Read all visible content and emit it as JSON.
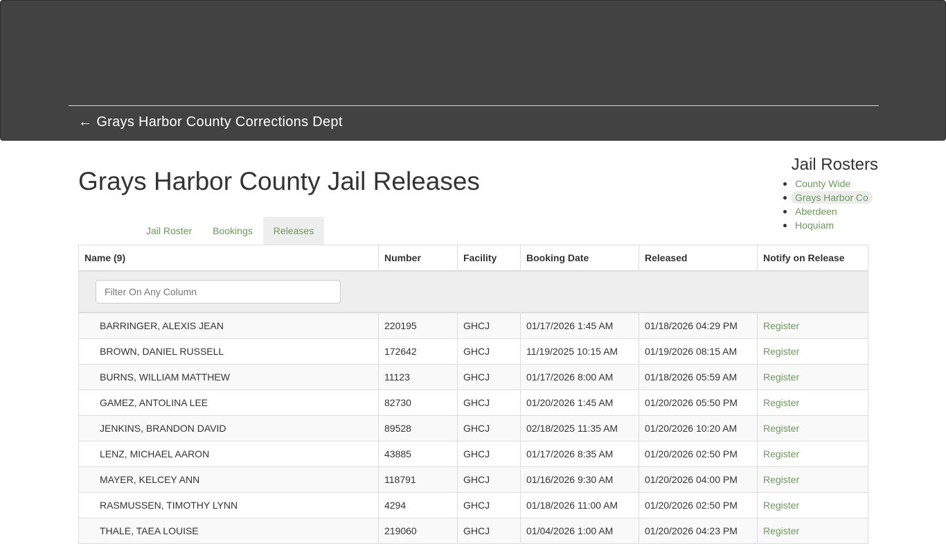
{
  "header": {
    "back_arrow": "←",
    "back_label": "Grays Harbor County Corrections Dept"
  },
  "page": {
    "title": "Grays Harbor County Jail Releases"
  },
  "rosters": {
    "title": "Jail Rosters",
    "items": [
      {
        "label": "County Wide",
        "active": false
      },
      {
        "label": "Grays Harbor Co",
        "active": true
      },
      {
        "label": "Aberdeen",
        "active": false
      },
      {
        "label": "Hoquiam",
        "active": false
      }
    ]
  },
  "tabs": [
    {
      "label": "Jail Roster",
      "active": false
    },
    {
      "label": "Bookings",
      "active": false
    },
    {
      "label": "Releases",
      "active": true
    }
  ],
  "table": {
    "columns": [
      "Name (9)",
      "Number",
      "Facility",
      "Booking Date",
      "Released",
      "Notify on Release"
    ],
    "filter_placeholder": "Filter On Any Column",
    "filter_value": "",
    "rows": [
      {
        "name": "BARRINGER, ALEXIS JEAN",
        "number": "220195",
        "facility": "GHCJ",
        "booking": "01/17/2026 1:45 AM",
        "released": "01/18/2026 04:29 PM",
        "notify": "Register"
      },
      {
        "name": "BROWN, DANIEL RUSSELL",
        "number": "172642",
        "facility": "GHCJ",
        "booking": "11/19/2025 10:15 AM",
        "released": "01/19/2026 08:15 AM",
        "notify": "Register"
      },
      {
        "name": "BURNS, WILLIAM MATTHEW",
        "number": "11123",
        "facility": "GHCJ",
        "booking": "01/17/2026 8:00 AM",
        "released": "01/18/2026 05:59 AM",
        "notify": "Register"
      },
      {
        "name": "GAMEZ, ANTOLINA LEE",
        "number": "82730",
        "facility": "GHCJ",
        "booking": "01/20/2026 1:45 AM",
        "released": "01/20/2026 05:50 PM",
        "notify": "Register"
      },
      {
        "name": "JENKINS, BRANDON DAVID",
        "number": "89528",
        "facility": "GHCJ",
        "booking": "02/18/2025 11:35 AM",
        "released": "01/20/2026 10:20 AM",
        "notify": "Register"
      },
      {
        "name": "LENZ, MICHAEL AARON",
        "number": "43885",
        "facility": "GHCJ",
        "booking": "01/17/2026 8:35 AM",
        "released": "01/20/2026 02:50 PM",
        "notify": "Register"
      },
      {
        "name": "MAYER, KELCEY ANN",
        "number": "118791",
        "facility": "GHCJ",
        "booking": "01/16/2026 9:30 AM",
        "released": "01/20/2026 04:00 PM",
        "notify": "Register"
      },
      {
        "name": "RASMUSSEN, TIMOTHY LYNN",
        "number": "4294",
        "facility": "GHCJ",
        "booking": "01/18/2026 11:00 AM",
        "released": "01/20/2026 02:50 PM",
        "notify": "Register"
      },
      {
        "name": "THALE, TAEA LOUISE",
        "number": "219060",
        "facility": "GHCJ",
        "booking": "01/04/2026 1:00 AM",
        "released": "01/20/2026 04:23 PM",
        "notify": "Register"
      }
    ]
  },
  "colors": {
    "header_bg": "#424242",
    "link_green": "#6b9a5a",
    "active_tab_bg": "#eeeeee"
  }
}
